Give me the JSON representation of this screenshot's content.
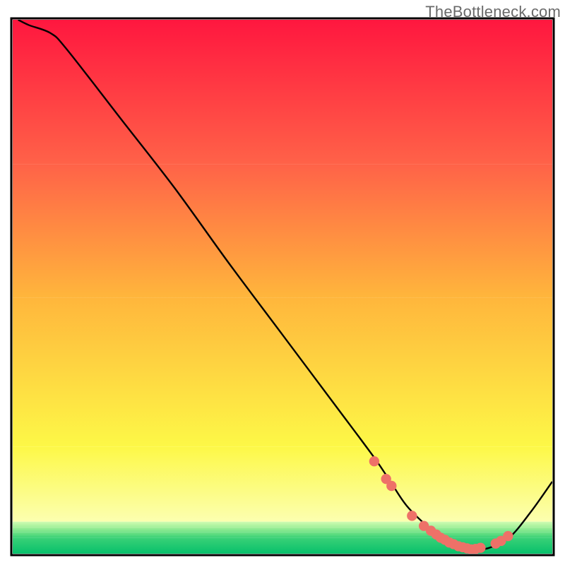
{
  "watermark": "TheBottleneck.com",
  "chart_data": {
    "type": "line",
    "title": "",
    "xlabel": "",
    "ylabel": "",
    "xlim": [
      0,
      100
    ],
    "ylim": [
      0,
      100
    ],
    "grid": false,
    "legend": false,
    "series": [
      {
        "name": "curve",
        "x": [
          1,
          3,
          7,
          10,
          20,
          30,
          40,
          50,
          60,
          67,
          70,
          73,
          77,
          80,
          83,
          85,
          88,
          92,
          96,
          100
        ],
        "y": [
          100,
          99,
          97.5,
          94.5,
          81.5,
          68.5,
          54.5,
          41,
          27.5,
          18,
          13.5,
          9,
          5,
          2.8,
          1.2,
          0.8,
          1.0,
          3.0,
          7.8,
          13.5
        ]
      }
    ],
    "markers": {
      "name": "scatter-points",
      "color": "#ee7168",
      "points": [
        {
          "x": 67.0,
          "y": 17.3
        },
        {
          "x": 69.2,
          "y": 14.0
        },
        {
          "x": 70.2,
          "y": 12.7
        },
        {
          "x": 74.0,
          "y": 7.1
        },
        {
          "x": 76.2,
          "y": 5.2
        },
        {
          "x": 77.5,
          "y": 4.3
        },
        {
          "x": 78.5,
          "y": 3.6
        },
        {
          "x": 79.3,
          "y": 3.0
        },
        {
          "x": 80.1,
          "y": 2.6
        },
        {
          "x": 80.9,
          "y": 2.1
        },
        {
          "x": 81.7,
          "y": 1.8
        },
        {
          "x": 82.6,
          "y": 1.4
        },
        {
          "x": 83.4,
          "y": 1.2
        },
        {
          "x": 84.2,
          "y": 1.0
        },
        {
          "x": 85.0,
          "y": 0.8
        },
        {
          "x": 85.8,
          "y": 0.9
        },
        {
          "x": 86.7,
          "y": 1.1
        },
        {
          "x": 89.5,
          "y": 1.9
        },
        {
          "x": 90.5,
          "y": 2.4
        },
        {
          "x": 91.8,
          "y": 3.3
        }
      ]
    },
    "background_bands": [
      {
        "y0": 100,
        "y1": 73,
        "top": "#ff173f",
        "bottom": "#ff6248"
      },
      {
        "y0": 73,
        "y1": 48,
        "top": "#ff6248",
        "bottom": "#ffb63c"
      },
      {
        "y0": 48,
        "y1": 20,
        "top": "#ffb63c",
        "bottom": "#fdf847"
      },
      {
        "y0": 20,
        "y1": 6,
        "top": "#fdf847",
        "bottom": "#fcffb0"
      },
      {
        "y0": 6,
        "y1": 5,
        "top": "#d0fcb2",
        "bottom": "#a4f19a"
      },
      {
        "y0": 5,
        "y1": 4,
        "top": "#a4f19a",
        "bottom": "#6fe286"
      },
      {
        "y0": 4,
        "y1": 3,
        "top": "#6fe286",
        "bottom": "#3ad177"
      },
      {
        "y0": 3,
        "y1": 0,
        "top": "#3ad177",
        "bottom": "#07c06b"
      }
    ]
  }
}
